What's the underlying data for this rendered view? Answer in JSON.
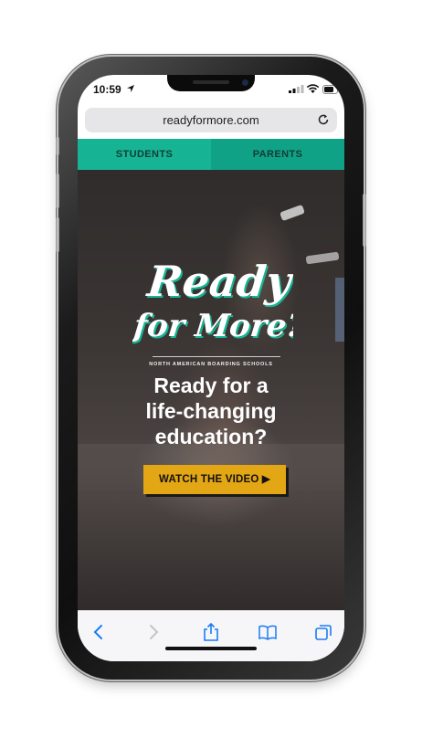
{
  "status_bar": {
    "time": "10:59"
  },
  "browser": {
    "url": "readyformore.com"
  },
  "tabs": [
    {
      "label": "STUDENTS"
    },
    {
      "label": "PARENTS"
    }
  ],
  "hero": {
    "logo_line1": "Ready",
    "logo_line2": "for More?",
    "tagline": "NORTH AMERICAN BOARDING SCHOOLS",
    "headline_line1": "Ready for a",
    "headline_line2": "life-changing",
    "headline_line3": "education?",
    "cta_label": "WATCH THE VIDEO ▶"
  },
  "toolbar": {
    "icons": [
      "back-icon",
      "forward-icon",
      "share-icon",
      "bookmarks-icon",
      "tabs-icon"
    ]
  },
  "colors": {
    "tab_students": "#16b494",
    "tab_parents": "#10a286",
    "cta": "#e3a614",
    "ios_blue": "#1a7cf5"
  }
}
